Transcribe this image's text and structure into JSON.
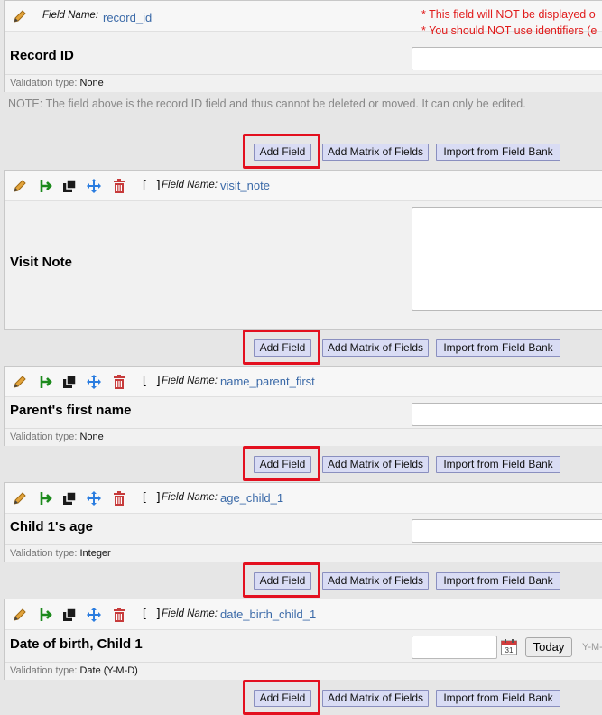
{
  "header_field": {
    "field_name_label": "Field Name:",
    "field_name": "record_id",
    "warnings": [
      "* This field will NOT be displayed o",
      "* You should NOT use identifiers (e"
    ],
    "label": "Record ID",
    "validation_label": "Validation type:",
    "validation": "None"
  },
  "note": "NOTE: The field above is the record ID field and thus cannot be deleted or moved. It can only be edited.",
  "buttons": {
    "add_field": "Add Field",
    "add_matrix": "Add Matrix of Fields",
    "import_bank": "Import from Field Bank"
  },
  "brackets": "[ ]",
  "field_name_label": "Field Name:",
  "validation_label": "Validation type:",
  "fields": [
    {
      "field_name": "visit_note",
      "label": "Visit Note"
    },
    {
      "field_name": "name_parent_first",
      "label": "Parent's first name",
      "validation": "None"
    },
    {
      "field_name": "age_child_1",
      "label": "Child 1's age",
      "validation": "Integer"
    },
    {
      "field_name": "date_birth_child_1",
      "label": "Date of birth, Child 1",
      "validation": "Date (Y-M-D)",
      "today_label": "Today",
      "format_hint": "Y-M-"
    }
  ],
  "colors": {
    "highlight": "#e3101f",
    "warning": "#e01b1b",
    "link": "#3b6aa8",
    "button": "#d9dcf4"
  },
  "icons": [
    "pencil-icon",
    "branching-icon",
    "copy-icon",
    "move-icon",
    "trash-icon",
    "calendar-icon"
  ]
}
